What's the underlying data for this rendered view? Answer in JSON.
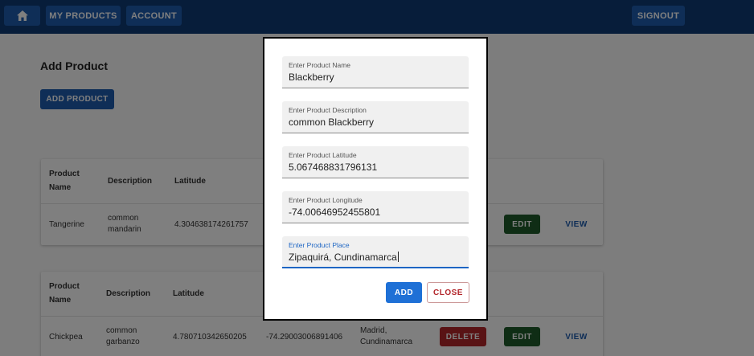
{
  "nav": {
    "home_icon": "home-icon",
    "my_products": "MY PRODUCTS",
    "account": "ACCOUNT",
    "signout": "SIGNOUT"
  },
  "page": {
    "title": "Add Product",
    "add_button": "ADD PRODUCT"
  },
  "table": {
    "headers": {
      "product_name": "Product Name",
      "description": "Description",
      "latitude": "Latitude"
    },
    "rows": [
      {
        "name": "Tangerine",
        "description": "common mandarin",
        "latitude": "4.304638174261757",
        "edit": "EDIT",
        "view": "VIEW"
      },
      {
        "name": "Chickpea",
        "description": "common garbanzo",
        "latitude": "4.780710342650205",
        "longitude": "-74.29003006891406",
        "place": "Madrid, Cundinamarca",
        "delete": "DELETE",
        "edit": "EDIT",
        "view": "VIEW"
      }
    ]
  },
  "dialog": {
    "fields": [
      {
        "label": "Enter Product Name",
        "value": "Blackberry"
      },
      {
        "label": "Enter Product Description",
        "value": "common Blackberry"
      },
      {
        "label": "Enter Product Latitude",
        "value": "5.067468831796131"
      },
      {
        "label": "Enter Product Longitude",
        "value": "-74.00646952455801"
      },
      {
        "label": "Enter Product Place",
        "value": "Zipaquirá, Cundinamarca"
      }
    ],
    "add_label": "ADD",
    "close_label": "CLOSE"
  },
  "colors": {
    "navbar": "#0f3a74",
    "primary": "#1e5cae",
    "edit": "#1e5a2a",
    "delete": "#b3262b",
    "focus": "#1e66c4"
  }
}
